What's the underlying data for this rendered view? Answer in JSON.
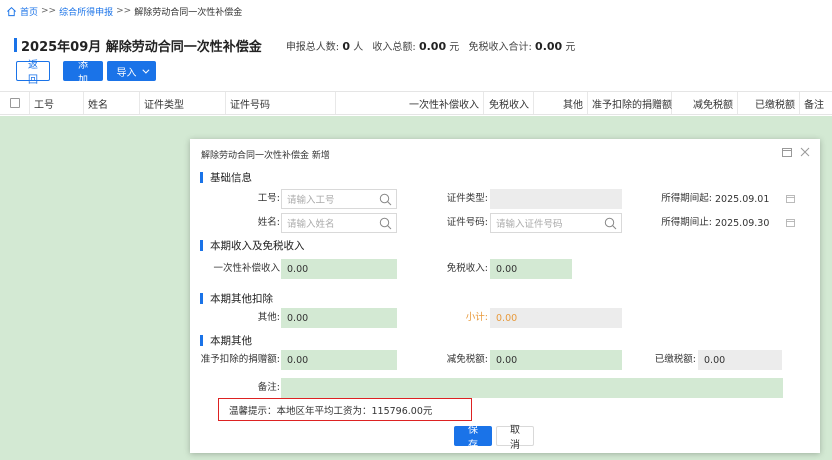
{
  "breadcrumb": {
    "items": [
      "首页",
      "综合所得申报",
      "解除劳动合同一次性补偿金"
    ],
    "sep": ">>"
  },
  "header": {
    "title": "2025年09月 解除劳动合同一次性补偿金",
    "count_label": "申报总人数:",
    "count_value": "0",
    "count_unit": "人",
    "income_label": "收入总额:",
    "income_value": "0.00",
    "income_unit": "元",
    "taxfree_label": "免税收入合计:",
    "taxfree_value": "0.00",
    "taxfree_unit": "元"
  },
  "toolbar": {
    "back_label": "返回",
    "add_label": "添加",
    "import_label": "导入"
  },
  "table": {
    "columns": [
      "工号",
      "姓名",
      "证件类型",
      "证件号码",
      "一次性补偿收入",
      "免税收入",
      "其他",
      "准予扣除的捐赠额",
      "减免税额",
      "已缴税额",
      "备注"
    ]
  },
  "modal": {
    "title": "解除劳动合同一次性补偿金 新增",
    "sections": {
      "basic": "基础信息",
      "income": "本期收入及免税收入",
      "deduct": "本期其他扣除",
      "other": "本期其他"
    },
    "fields": {
      "emp_id_label": "工号:",
      "emp_id_placeholder": "请输入工号",
      "name_label": "姓名:",
      "name_placeholder": "请输入姓名",
      "id_type_label": "证件类型:",
      "id_no_label": "证件号码:",
      "id_no_placeholder": "请输入证件号码",
      "period_start_label": "所得期间起:",
      "period_start_value": "2025.09.01",
      "period_end_label": "所得期间止:",
      "period_end_value": "2025.09.30",
      "lump_label": "一次性补偿收入",
      "lump_value": "0.00",
      "taxfree_label": "免税收入:",
      "taxfree_value": "0.00",
      "other_label": "其他:",
      "other_value": "0.00",
      "subtotal_label": "小计:",
      "subtotal_value": "0.00",
      "donation_label": "准予扣除的捐赠额:",
      "donation_value": "0.00",
      "reduce_label": "减免税额:",
      "reduce_value": "0.00",
      "paid_label": "已缴税额:",
      "paid_value": "0.00",
      "remark_label": "备注:"
    },
    "tip": "温馨提示：本地区年平均工资为：115796.00元",
    "save_label": "保存",
    "cancel_label": "取消"
  },
  "colors": {
    "accent": "#1a73e8",
    "green_bg": "#d3e9d3",
    "tip_border": "#dd2222",
    "subtotal": "#e89a3c"
  }
}
